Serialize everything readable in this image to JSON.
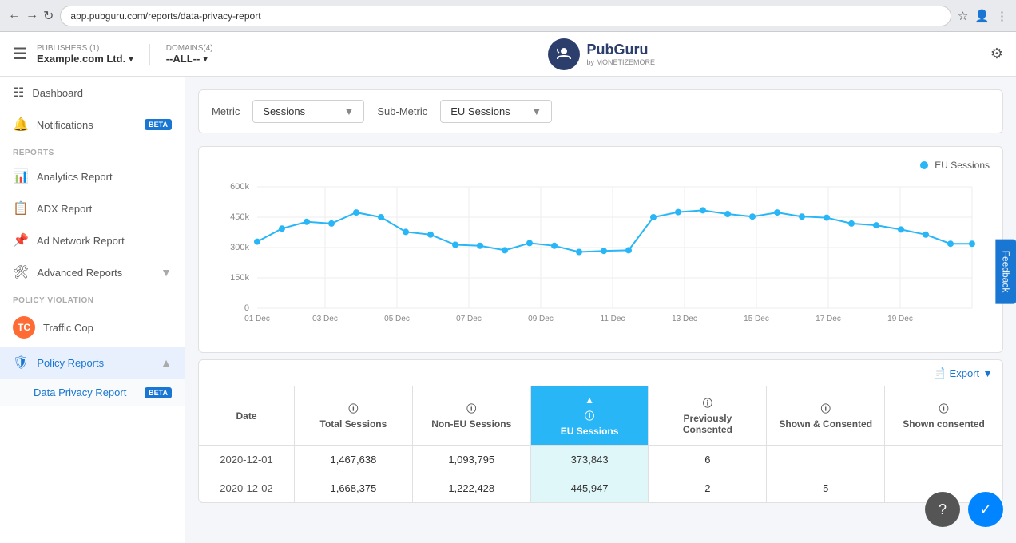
{
  "browser": {
    "url": "app.pubguru.com/reports/data-privacy-report"
  },
  "topnav": {
    "hamburger": "☰",
    "publishers_label": "PUBLISHERS (1)",
    "publishers_value": "Example.com Ltd.",
    "domains_label": "DOMAINS(4)",
    "domains_value": "--ALL--",
    "logo_icon": "🎩",
    "logo_name": "PubGuru",
    "logo_sub": "by MONETIZEMORE",
    "settings_icon": "⚙"
  },
  "sidebar": {
    "dashboard_label": "Dashboard",
    "notifications_label": "Notifications",
    "notifications_badge": "BETA",
    "reports_section": "REPORTS",
    "analytics_label": "Analytics Report",
    "adx_label": "ADX Report",
    "adnetwork_label": "Ad Network Report",
    "advanced_label": "Advanced Reports",
    "policy_section": "POLICY VIOLATION",
    "trafficcop_label": "Traffic Cop",
    "policyreports_label": "Policy Reports",
    "dataprivacy_label": "Data Privacy Report",
    "dataprivacy_badge": "BETA"
  },
  "metric_controls": {
    "metric_label": "Metric",
    "metric_value": "Sessions",
    "submetric_label": "Sub-Metric",
    "submetric_value": "EU Sessions"
  },
  "chart": {
    "legend_label": "EU Sessions",
    "y_labels": [
      "600k",
      "450k",
      "300k",
      "150k",
      "0"
    ],
    "x_labels": [
      "01 Dec",
      "03 Dec",
      "05 Dec",
      "07 Dec",
      "09 Dec",
      "11 Dec",
      "13 Dec",
      "15 Dec",
      "17 Dec",
      "19 Dec"
    ],
    "data_points": [
      330,
      380,
      430,
      420,
      475,
      450,
      375,
      360,
      315,
      310,
      290,
      320,
      310,
      280,
      285,
      290,
      450,
      480,
      490,
      470,
      460,
      475,
      460,
      455,
      420,
      410,
      390,
      370,
      320,
      320
    ]
  },
  "table": {
    "export_label": "Export",
    "columns": {
      "date": "Date",
      "total_sessions": "Total Sessions",
      "non_eu_sessions": "Non-EU Sessions",
      "eu_sessions": "EU Sessions",
      "previously_consented": "Previously Consented",
      "shown_consented": "Shown & Consented",
      "shown_consented2": "Shown consented"
    },
    "rows": [
      {
        "date": "2020-12-01",
        "total_sessions": "1,467,638",
        "non_eu_sessions": "1,093,795",
        "eu_sessions": "373,843",
        "previously_consented": "6",
        "shown_consented": "",
        "shown_consented2": ""
      },
      {
        "date": "2020-12-02",
        "total_sessions": "1,668,375",
        "non_eu_sessions": "1,222,428",
        "eu_sessions": "445,947",
        "previously_consented": "2",
        "shown_consented": "5",
        "shown_consented2": ""
      }
    ]
  },
  "feedback": {
    "label": "Feedback"
  },
  "chat_help_icon": "?",
  "chat_messenger_icon": "✉"
}
